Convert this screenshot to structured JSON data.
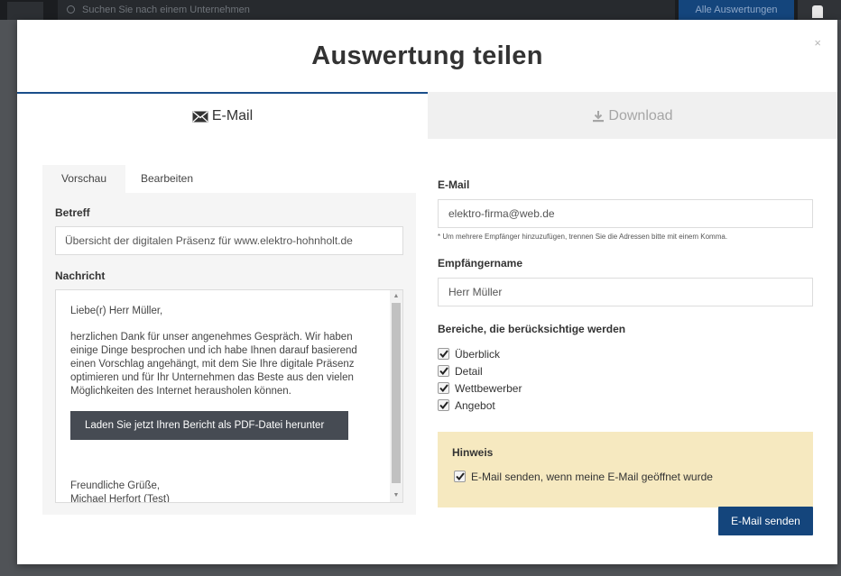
{
  "background": {
    "search_placeholder": "Suchen Sie nach einem Unternehmen",
    "all_button": "Alle Auswertungen"
  },
  "modal": {
    "title": "Auswertung teilen",
    "close_symbol": "×",
    "tabs": [
      {
        "label": "E-Mail",
        "icon": "envelope-icon",
        "active": true
      },
      {
        "label": "Download",
        "icon": "download-icon",
        "active": false
      }
    ]
  },
  "left": {
    "subtabs": [
      {
        "label": "Vorschau",
        "active": true
      },
      {
        "label": "Bearbeiten",
        "active": false
      }
    ],
    "subject_label": "Betreff",
    "subject_value": "Übersicht der digitalen Präsenz für www.elektro-hohnholt.de",
    "message_label": "Nachricht",
    "message": {
      "greeting": "Liebe(r) Herr Müller,",
      "body": "herzlichen Dank für unser angenehmes Gespräch. Wir haben einige Dinge besprochen und ich habe Ihnen darauf basierend einen Vorschlag angehängt, mit dem Sie Ihre digitale Präsenz optimieren und für Ihr Unternehmen das Beste aus den vielen Möglichkeiten des Internet herausholen können.",
      "pdf_button": "Laden Sie jetzt Ihren Bericht als PDF-Datei herunter",
      "closing": "Freundliche Grüße,",
      "signature": "Michael Herfort (Test)"
    }
  },
  "right": {
    "email_label": "E-Mail",
    "email_value": "elektro-firma@web.de",
    "email_hint": "* Um mehrere Empfänger hinzuzufügen, trennen Sie die Adressen bitte mit einem Komma.",
    "name_label": "Empfängername",
    "name_value": "Herr Müller",
    "sections_label": "Bereiche, die berücksichtige werden",
    "sections": [
      {
        "label": "Überblick",
        "checked": true
      },
      {
        "label": "Detail",
        "checked": true
      },
      {
        "label": "Wettbewerber",
        "checked": true
      },
      {
        "label": "Angebot",
        "checked": true
      }
    ],
    "notice_title": "Hinweis",
    "notice_option": "E-Mail senden, wenn meine E-Mail geöffnet wurde",
    "notice_checked": true,
    "send_button": "E-Mail senden"
  },
  "colors": {
    "primary": "#14457c",
    "notice_bg": "#f6e9c0",
    "pdf_button": "#464b53"
  }
}
